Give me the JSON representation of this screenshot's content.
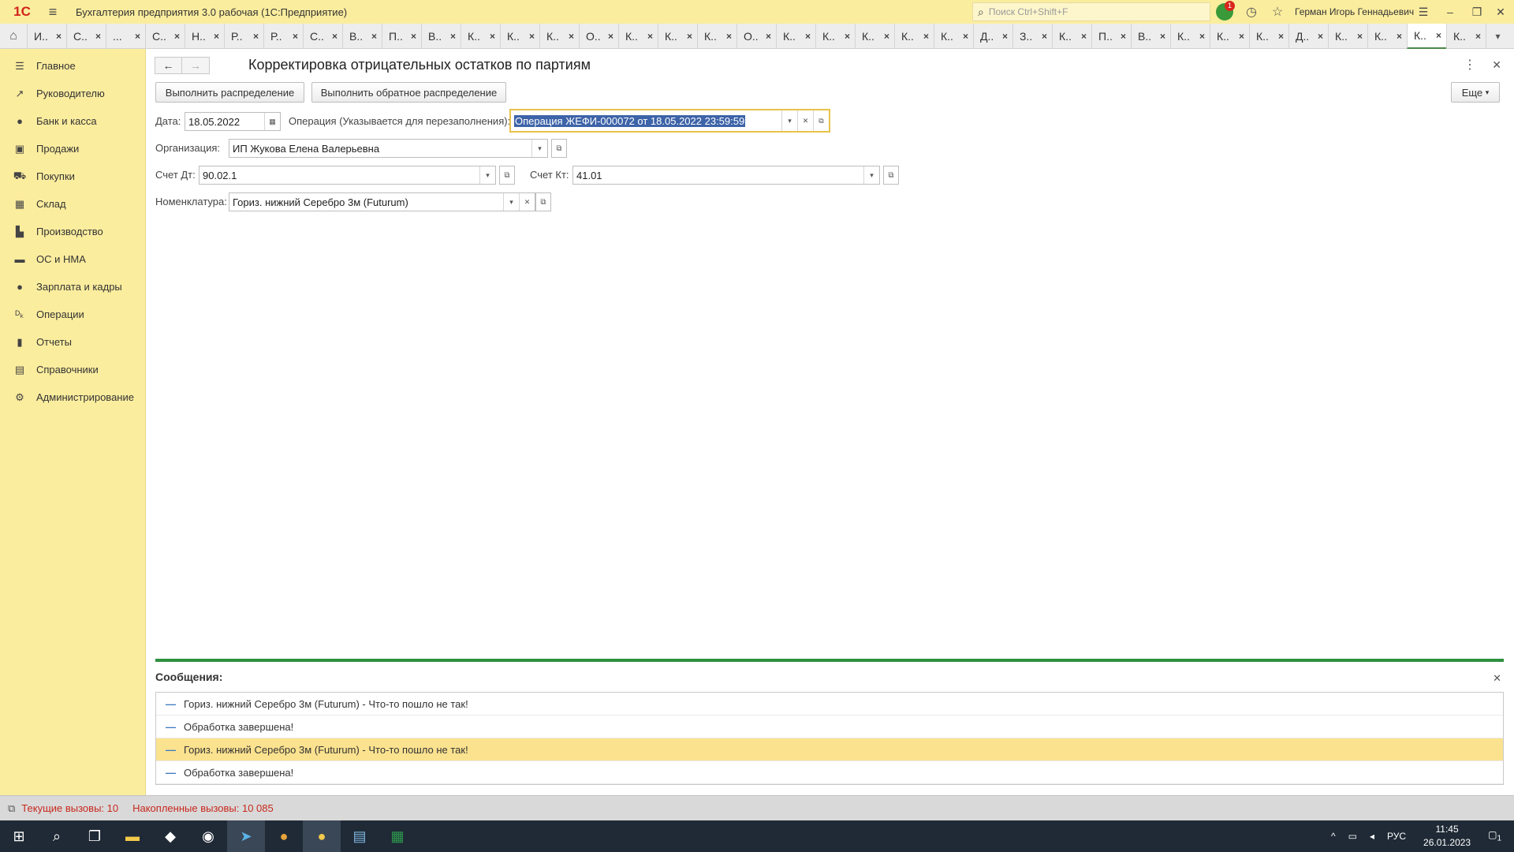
{
  "titlebar": {
    "logo": "1С",
    "app_title": "Бухгалтерия предприятия 3.0 рабочая  (1С:Предприятие)",
    "search_placeholder": "Поиск Ctrl+Shift+F",
    "notif_count": "1",
    "username": "Герман Игорь Геннадьевич"
  },
  "tabs": [
    "И..",
    "С..",
    "...",
    "С..",
    "Н..",
    "Р..",
    "Р..",
    "С..",
    "В..",
    "П..",
    "В..",
    "К..",
    "К..",
    "К..",
    "О..",
    "К..",
    "К..",
    "К..",
    "О..",
    "К..",
    "К..",
    "К..",
    "К..",
    "К..",
    "Д..",
    "З..",
    "К..",
    "П..",
    "В..",
    "К..",
    "К..",
    "К..",
    "Д..",
    "К..",
    "К..",
    "К..",
    "К.."
  ],
  "active_tab_index": 35,
  "sidebar": {
    "items": [
      {
        "label": "Главное",
        "icon": "menu-icon"
      },
      {
        "label": "Руководителю",
        "icon": "trend-icon"
      },
      {
        "label": "Банк и касса",
        "icon": "bank-icon"
      },
      {
        "label": "Продажи",
        "icon": "bag-icon"
      },
      {
        "label": "Покупки",
        "icon": "cart-icon"
      },
      {
        "label": "Склад",
        "icon": "warehouse-icon"
      },
      {
        "label": "Производство",
        "icon": "factory-icon"
      },
      {
        "label": "ОС и НМА",
        "icon": "truck-icon"
      },
      {
        "label": "Зарплата и кадры",
        "icon": "person-icon"
      },
      {
        "label": "Операции",
        "icon": "dt-kt-icon"
      },
      {
        "label": "Отчеты",
        "icon": "bar-chart-icon"
      },
      {
        "label": "Справочники",
        "icon": "book-icon"
      },
      {
        "label": "Администрирование",
        "icon": "gear-icon"
      }
    ]
  },
  "form": {
    "title": "Корректировка отрицательных остатков по партиям",
    "btn_distribute": "Выполнить распределение",
    "btn_reverse": "Выполнить обратное распределение",
    "btn_more": "Еще",
    "date_label": "Дата:",
    "date_value": "18.05.2022",
    "operation_label": "Операция (Указывается для перезаполнения):",
    "operation_value": "Операция ЖЕФИ-000072 от 18.05.2022 23:59:59",
    "org_label": "Организация:",
    "org_value": "ИП Жукова Елена Валерьевна",
    "debit_label": "Счет Дт:",
    "debit_value": "90.02.1",
    "credit_label": "Счет Кт:",
    "credit_value": "41.01",
    "item_label": "Номенклатура:",
    "item_value": "Гориз. нижний Серебро 3м (Futurum)"
  },
  "messages": {
    "title": "Сообщения:",
    "rows": [
      {
        "text": "Гориз. нижний Серебро 3м (Futurum)  - Что-то пошло не так!",
        "selected": false
      },
      {
        "text": "Обработка завершена!",
        "selected": false
      },
      {
        "text": "Гориз. нижний Серебро 3м (Futurum)  - Что-то пошло не так!",
        "selected": true
      },
      {
        "text": "Обработка завершена!",
        "selected": false
      }
    ]
  },
  "statusbar": {
    "current_calls": "Текущие вызовы: 10",
    "accum_calls": "Накопленные вызовы: 10 085"
  },
  "taskbar": {
    "lang": "РУС",
    "time": "11:45",
    "date": "26.01.2023",
    "notif": "1"
  },
  "colors": {
    "accent_yellow": "#fbed9e",
    "selection_blue": "#3d63a8",
    "message_divider": "#2e9040",
    "status_red": "#c8281e"
  }
}
